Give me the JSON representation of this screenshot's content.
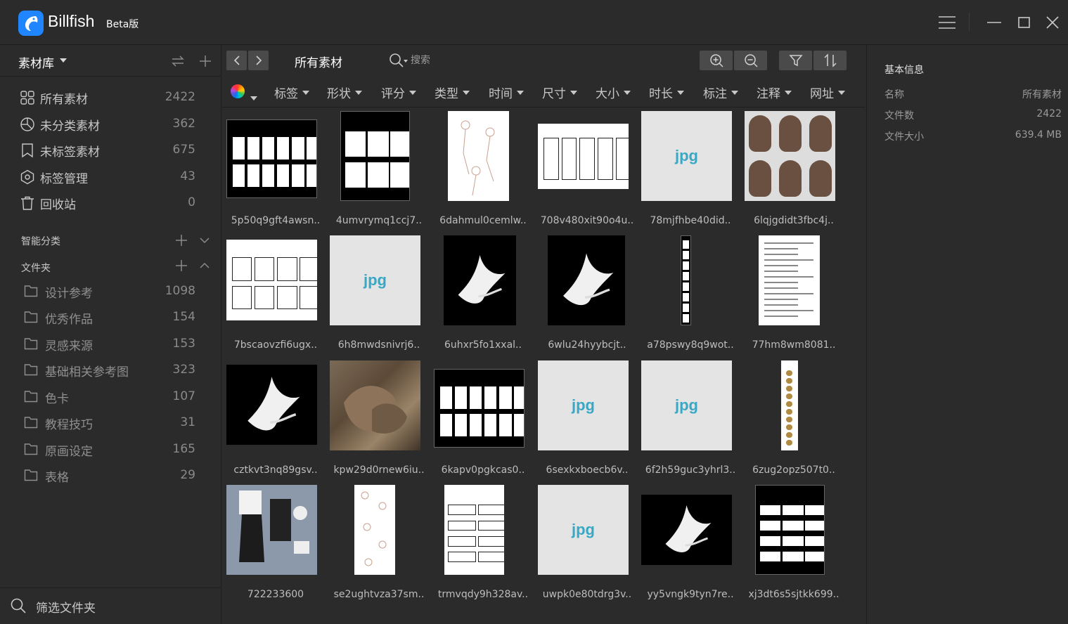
{
  "app": {
    "name": "Billfish",
    "beta": "Beta版"
  },
  "sidebar": {
    "library_title": "素材库",
    "nav": [
      {
        "label": "所有素材",
        "count": "2422",
        "icon": "grid-icon"
      },
      {
        "label": "未分类素材",
        "count": "362",
        "icon": "pie-icon"
      },
      {
        "label": "未标签素材",
        "count": "675",
        "icon": "bookmark-icon"
      },
      {
        "label": "标签管理",
        "count": "43",
        "icon": "tag-icon"
      },
      {
        "label": "回收站",
        "count": "0",
        "icon": "trash-icon"
      }
    ],
    "smart_title": "智能分类",
    "folders_title": "文件夹",
    "folders": [
      {
        "label": "设计参考",
        "count": "1098"
      },
      {
        "label": "优秀作品",
        "count": "154"
      },
      {
        "label": "灵感来源",
        "count": "153"
      },
      {
        "label": "基础相关参考图",
        "count": "323"
      },
      {
        "label": "色卡",
        "count": "107"
      },
      {
        "label": "教程技巧",
        "count": "31"
      },
      {
        "label": "原画设定",
        "count": "165"
      },
      {
        "label": "表格",
        "count": "29"
      }
    ],
    "filter_folder": "筛选文件夹"
  },
  "toolbar": {
    "title": "所有素材",
    "search_placeholder": "搜索"
  },
  "filters": [
    "标签",
    "形状",
    "评分",
    "类型",
    "时间",
    "尺寸",
    "大小",
    "时长",
    "标注",
    "注释",
    "网址"
  ],
  "items": [
    {
      "name": "5p50q9gft4awsn..",
      "kind": "sheet-dark"
    },
    {
      "name": "4umvrymq1ccj7..",
      "kind": "sheet-dark-tall"
    },
    {
      "name": "6dahmul0cemlw..",
      "kind": "sketch"
    },
    {
      "name": "708v480xit90o4u..",
      "kind": "sheet-light-wide"
    },
    {
      "name": "78mjfhbe40did..",
      "kind": "placeholder",
      "label": "jpg"
    },
    {
      "name": "6lqjgdidt3fbc4j..",
      "kind": "hair"
    },
    {
      "name": "7bscaovzfi6ugx..",
      "kind": "sheet-light"
    },
    {
      "name": "6h8mwdsnivrj6..",
      "kind": "placeholder",
      "label": "jpg"
    },
    {
      "name": "6uhxr5fo1xxal..",
      "kind": "dove-tall"
    },
    {
      "name": "6wlu24hyybcjt..",
      "kind": "dove"
    },
    {
      "name": "a78pswy8q9wot..",
      "kind": "strip"
    },
    {
      "name": "77hm8wm8081..",
      "kind": "doc"
    },
    {
      "name": "cztkvt3nq89gsv..",
      "kind": "dove-wide"
    },
    {
      "name": "kpw29d0rnew6iu..",
      "kind": "wolves"
    },
    {
      "name": "6kapv0pgkcas0..",
      "kind": "sheet-dark"
    },
    {
      "name": "6sexkxboecb6v..",
      "kind": "placeholder",
      "label": "jpg"
    },
    {
      "name": "6f2h59guc3yhrl3..",
      "kind": "placeholder",
      "label": "jpg"
    },
    {
      "name": "6zug2opz507t0..",
      "kind": "strip-light"
    },
    {
      "name": "722233600",
      "kind": "fashion"
    },
    {
      "name": "se2ughtvza37sm..",
      "kind": "sketch-tall"
    },
    {
      "name": "trmvqdy9h328av..",
      "kind": "sheet-light-tall"
    },
    {
      "name": "uwpk0e80tdrg3v..",
      "kind": "placeholder",
      "label": "jpg"
    },
    {
      "name": "yy5vngk9tyn7re..",
      "kind": "dove-wide2"
    },
    {
      "name": "xj3dt6s5sjtkk699..",
      "kind": "sheet-dark-tall2"
    }
  ],
  "info": {
    "title": "基本信息",
    "rows": [
      {
        "k": "名称",
        "v": "所有素材"
      },
      {
        "k": "文件数",
        "v": "2422"
      },
      {
        "k": "文件大小",
        "v": "639.4 MB"
      }
    ]
  }
}
